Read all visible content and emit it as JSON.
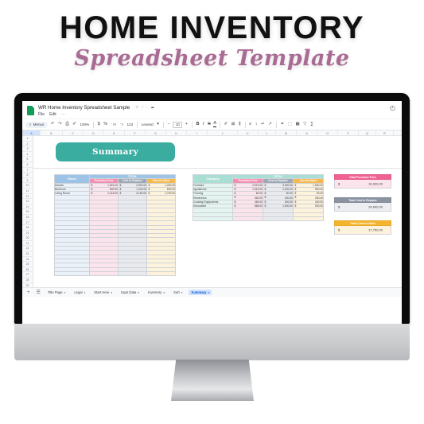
{
  "poster": {
    "title_main": "HOME INVENTORY",
    "title_sub": "Spreadsheet Template",
    "accent_pink": "#a96b94"
  },
  "app": {
    "doc_name": "WR Home Inventory Spreadsheet Sample",
    "menus": [
      "File",
      "Edit"
    ],
    "menu_overflow": "⋯",
    "title_icons": [
      "star-icon",
      "folder-move-icon",
      "cloud-status-icon"
    ],
    "history_icon": "◴"
  },
  "toolbar": {
    "menus_pill": "Menus",
    "search_icon": "⌕",
    "undo_icon": "↶",
    "redo_icon": "↷",
    "print_icon": "⎙",
    "paint_icon": "✐",
    "zoom_value": "100%",
    "currency_icon": "$",
    "percent_icon": "%",
    "decimal_dec_icon": "·₀₀",
    "decimal_inc_icon": "·₀",
    "more_formats_icon": "123",
    "font_family": "Lexend",
    "font_minus": "−",
    "font_size": "10",
    "font_plus": "+",
    "bold_icon": "B",
    "italic_icon": "I",
    "strike_icon": "S",
    "text_color_icon": "A",
    "fill_color_icon": "✐",
    "borders_icon": "⊞",
    "merge_icon": "⫼",
    "halign_icon": "≡",
    "valign_icon": "↕",
    "wrap_icon": "↵",
    "rotate_icon": "↗",
    "link_icon": "⚭",
    "comment_icon": "⬚",
    "chart_icon": "▦",
    "filter_icon": "▽",
    "functions_icon": "∑"
  },
  "grid": {
    "columns": [
      "A",
      "B",
      "C",
      "D",
      "E",
      "F",
      "G",
      "H",
      "I",
      "J",
      "K",
      "L",
      "M",
      "N",
      "O",
      "P",
      "Q",
      "R",
      "S",
      "T"
    ],
    "selected_column": "A",
    "row_count": 29
  },
  "sheet": {
    "banner_label": "Summary",
    "banner_color": "#3aada0"
  },
  "room_table": {
    "header_label": "Room",
    "total_label": "TOTAL",
    "columns": [
      "Purchase Price",
      "Cost to Replace",
      "Current Value"
    ],
    "rows": [
      {
        "room": "Kitchen",
        "purchase_price": "1,524.00",
        "cost_to_replace": "2,900.00",
        "current_value": "1,250.00"
      },
      {
        "room": "Bedroom",
        "purchase_price": "800.00",
        "cost_to_replace": "1,200.00",
        "current_value": "600.00"
      },
      {
        "room": "Living Room",
        "purchase_price": "2,218.00",
        "cost_to_replace": "3,160.00",
        "current_value": "1,700.00"
      }
    ],
    "blank_row_count": 19,
    "currency_symbol": "$"
  },
  "category_table": {
    "header_label": "Category",
    "total_label": "TOTAL",
    "columns": [
      "Purchase Price",
      "Cost to Replace",
      "Current Value"
    ],
    "rows": [
      {
        "category": "Furniture",
        "purchase_price": "2,519.00",
        "cost_to_replace": "3,500.00",
        "current_value": "1,950.00"
      },
      {
        "category": "Appliances",
        "purchase_price": "1,515.00",
        "cost_to_replace": "2,000.00",
        "current_value": "950.00"
      },
      {
        "category": "Flooring",
        "purchase_price": "80.00",
        "cost_to_replace": "80.00",
        "current_value": "50.00"
      },
      {
        "category": "Electronics",
        "purchase_price": "360.00",
        "cost_to_replace": "400.00",
        "current_value": "250.00"
      },
      {
        "category": "Cooking Equipments",
        "purchase_price": "460.00",
        "cost_to_replace": "500.00",
        "current_value": "400.00"
      },
      {
        "category": "Decorative",
        "purchase_price": "888.00",
        "cost_to_replace": "1,500.00",
        "current_value": "900.00"
      }
    ],
    "blank_row_count": 3,
    "currency_symbol": "$"
  },
  "totals": [
    {
      "label": "Total Purchase Price",
      "currency": "$",
      "value": "16,939.00",
      "color": "#f06292"
    },
    {
      "label": "Total Cost to Replace",
      "currency": "$",
      "value": "24,690.00",
      "color": "#8b93a1"
    },
    {
      "label": "Total Current Value",
      "currency": "$",
      "value": "17,750.00",
      "color": "#f5b42e"
    }
  ],
  "tabs": {
    "add_icon": "+",
    "all_sheets_icon": "☰",
    "items": [
      {
        "label": "Title Page",
        "active": false
      },
      {
        "label": "Legal",
        "active": false
      },
      {
        "label": "Start Here",
        "active": false
      },
      {
        "label": "Input Data",
        "active": false
      },
      {
        "label": "Inventory",
        "active": false
      },
      {
        "label": "Sort",
        "active": false
      },
      {
        "label": "Summary",
        "active": true
      }
    ],
    "caret": "▾"
  }
}
